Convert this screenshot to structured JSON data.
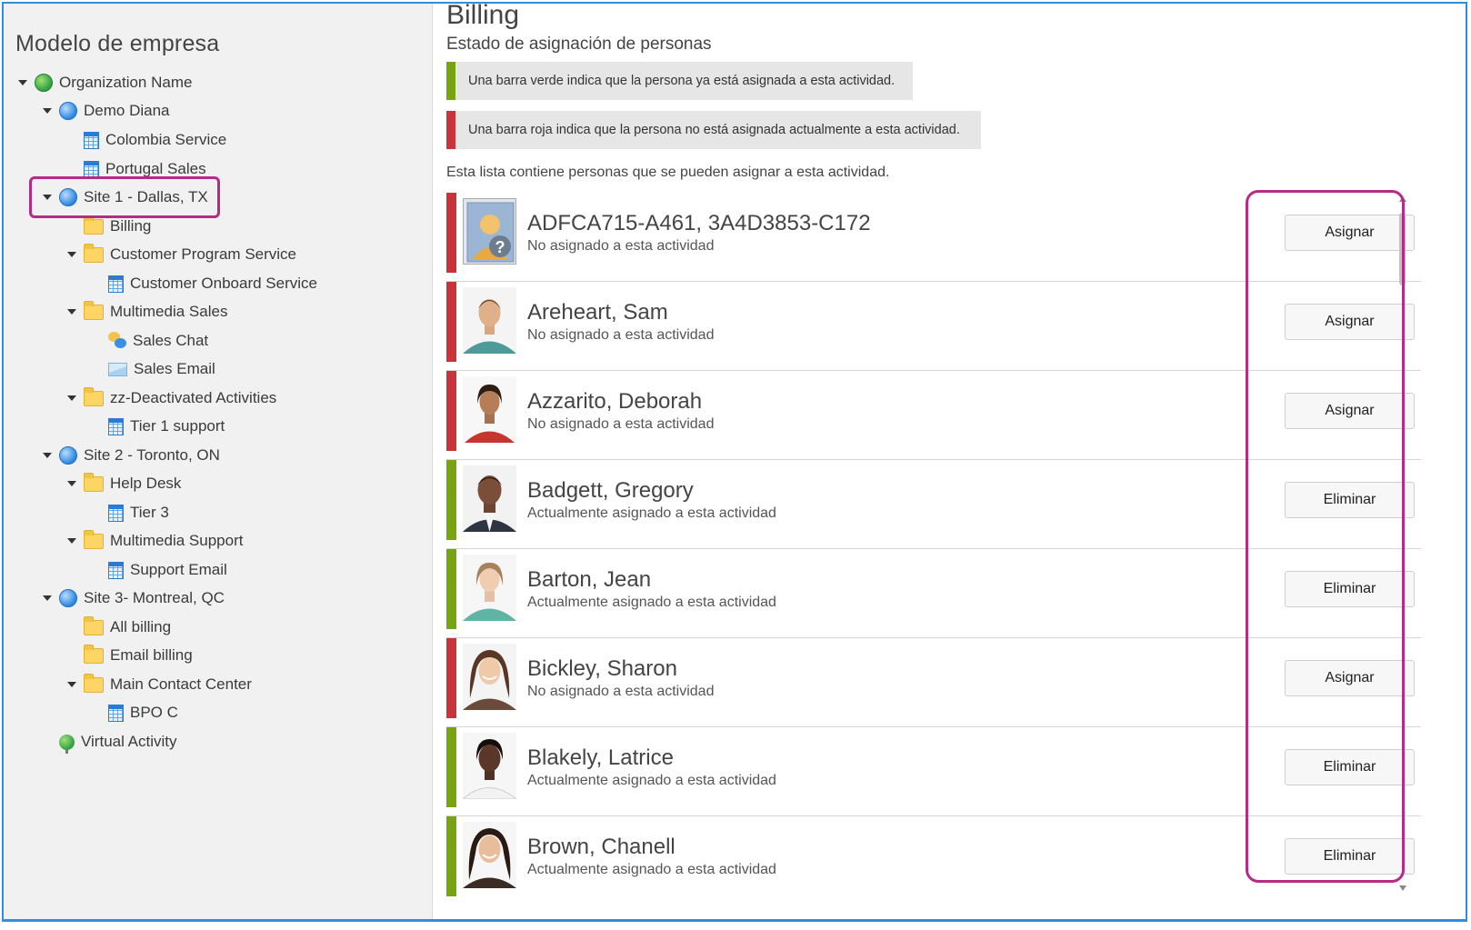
{
  "sidebar": {
    "title": "Modelo de empresa",
    "tree": [
      {
        "label": "Organization Name",
        "icon": "org-globe-icon"
      },
      {
        "label": "Demo Diana",
        "icon": "site-globe-icon"
      },
      {
        "label": "Colombia Service",
        "icon": "activity-icon"
      },
      {
        "label": "Portugal Sales",
        "icon": "activity-icon"
      },
      {
        "label": "Site 1 - Dallas, TX",
        "icon": "site-globe-icon"
      },
      {
        "label": "Billing",
        "icon": "folder-icon"
      },
      {
        "label": "Customer Program Service",
        "icon": "folder-icon"
      },
      {
        "label": "Customer Onboard Service",
        "icon": "activity-icon"
      },
      {
        "label": "Multimedia Sales",
        "icon": "folder-icon"
      },
      {
        "label": "Sales Chat",
        "icon": "chat-icon"
      },
      {
        "label": "Sales Email",
        "icon": "email-icon"
      },
      {
        "label": "zz-Deactivated Activities",
        "icon": "folder-icon"
      },
      {
        "label": "Tier 1 support",
        "icon": "activity-icon"
      },
      {
        "label": "Site 2 - Toronto, ON",
        "icon": "site-globe-icon"
      },
      {
        "label": "Help Desk",
        "icon": "folder-icon"
      },
      {
        "label": "Tier 3",
        "icon": "activity-icon"
      },
      {
        "label": "Multimedia Support",
        "icon": "folder-icon"
      },
      {
        "label": "Support Email",
        "icon": "activity-icon"
      },
      {
        "label": "Site 3- Montreal, QC",
        "icon": "site-globe-icon"
      },
      {
        "label": "All billing",
        "icon": "folder-icon"
      },
      {
        "label": "Email billing",
        "icon": "folder-icon"
      },
      {
        "label": "Main Contact Center",
        "icon": "folder-icon"
      },
      {
        "label": "BPO C",
        "icon": "activity-icon"
      },
      {
        "label": "Virtual Activity",
        "icon": "virtual-activity-icon"
      }
    ]
  },
  "main": {
    "title": "Billing",
    "subtitle": "Estado de asignación de personas",
    "legend_green": "Una barra verde indica que la persona ya está asignada a esta actividad.",
    "legend_red": "Una barra roja indica que la persona no está asignada actualmente a esta actividad.",
    "list_caption": "Esta lista contiene personas que se pueden asignar a esta actividad.",
    "people": [
      {
        "name": "ADFCA715-A461, 3A4D3853-C172",
        "status": "No asignado a esta actividad",
        "action": "Asignar",
        "assigned": false
      },
      {
        "name": "Areheart, Sam",
        "status": "No asignado a esta actividad",
        "action": "Asignar",
        "assigned": false
      },
      {
        "name": "Azzarito, Deborah",
        "status": "No asignado a esta actividad",
        "action": "Asignar",
        "assigned": false
      },
      {
        "name": "Badgett, Gregory",
        "status": "Actualmente asignado a esta actividad",
        "action": "Eliminar",
        "assigned": true
      },
      {
        "name": "Barton, Jean",
        "status": "Actualmente asignado a esta actividad",
        "action": "Eliminar",
        "assigned": true
      },
      {
        "name": "Bickley, Sharon",
        "status": "No asignado a esta actividad",
        "action": "Asignar",
        "assigned": false
      },
      {
        "name": "Blakely, Latrice",
        "status": "Actualmente asignado a esta actividad",
        "action": "Eliminar",
        "assigned": true
      },
      {
        "name": "Brown, Chanell",
        "status": "Actualmente asignado a esta actividad",
        "action": "Eliminar",
        "assigned": true
      }
    ]
  },
  "colors": {
    "assigned": "#78a414",
    "unassigned": "#c9343a",
    "highlight": "#b52b86",
    "frame": "#2f8fd8"
  }
}
